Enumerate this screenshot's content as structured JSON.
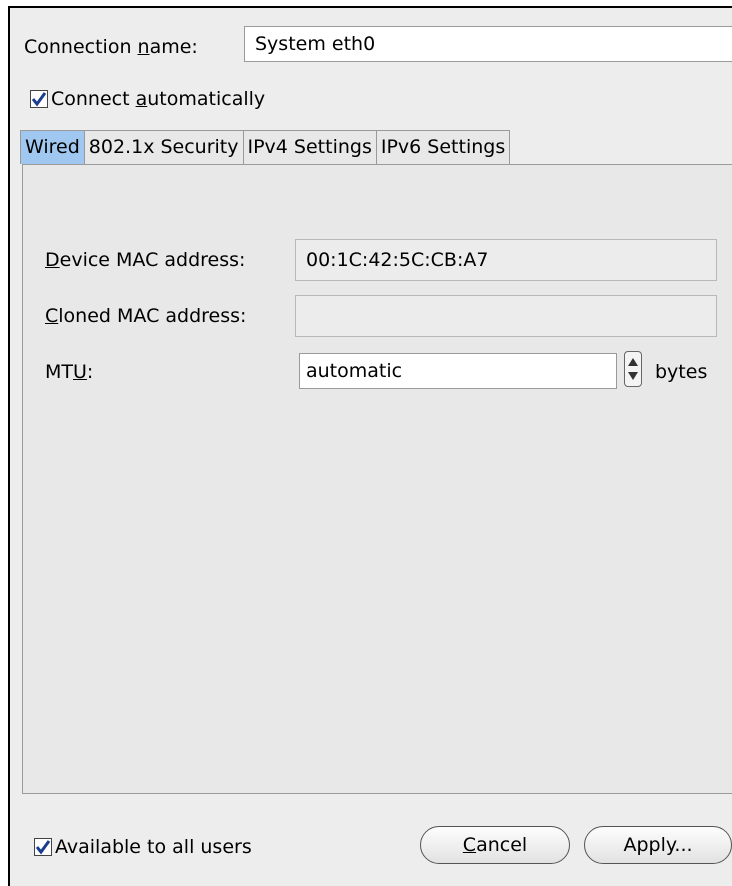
{
  "connection_name": {
    "label_before": "Connection ",
    "label_mnemonic": "n",
    "label_after": "ame:",
    "value": "System eth0"
  },
  "connect_automatically": {
    "checked": true,
    "label_before": "Connect ",
    "label_mnemonic": "a",
    "label_after": "utomatically"
  },
  "tabs": [
    {
      "label": "Wired",
      "active": true
    },
    {
      "label": "802.1x Security",
      "active": false
    },
    {
      "label": "IPv4 Settings",
      "active": false
    },
    {
      "label": "IPv6 Settings",
      "active": false
    }
  ],
  "wired": {
    "device_mac": {
      "label_mnemonic": "D",
      "label_after": "evice MAC address:",
      "value": "00:1C:42:5C:CB:A7"
    },
    "cloned_mac": {
      "label_mnemonic": "C",
      "label_after": "loned MAC address:",
      "value": ""
    },
    "mtu": {
      "label_before": "MT",
      "label_mnemonic": "U",
      "label_after": ":",
      "value": "automatic",
      "unit": "bytes"
    }
  },
  "footer": {
    "available_all_users": {
      "checked": true,
      "label": "Available to all users"
    },
    "cancel": {
      "label_mnemonic": "C",
      "label_after": "ancel"
    },
    "apply": {
      "label": "Apply..."
    }
  },
  "icons": {
    "checkmark": "checkmark-icon",
    "spin_up": "arrow-up-icon",
    "spin_down": "arrow-down-icon"
  },
  "colors": {
    "active_tab": "#9fc7ef",
    "window_bg": "#ededed",
    "panel_bg": "#e8e8e8"
  }
}
